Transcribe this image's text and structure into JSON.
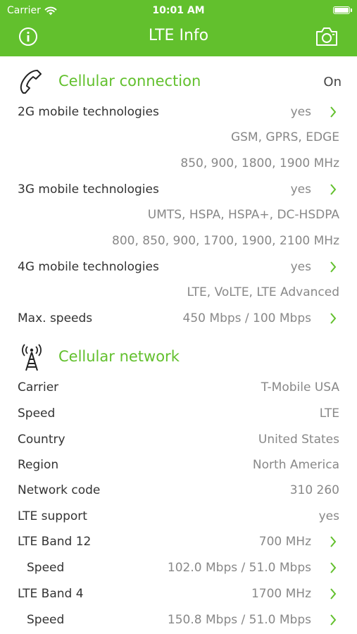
{
  "status_bar": {
    "carrier": "Carrier",
    "time": "10:01 AM"
  },
  "nav": {
    "title": "LTE Info",
    "left_icon": "info-icon",
    "right_icon": "camera-icon"
  },
  "accent_color": "#62c02d",
  "sections": {
    "cellular_connection": {
      "title": "Cellular connection",
      "status": "On",
      "icon": "phone-icon",
      "rows": [
        {
          "label": "2G mobile technologies",
          "value": "yes"
        },
        {
          "label": "",
          "value": "GSM, GPRS, EDGE"
        },
        {
          "label": "",
          "value": "850, 900, 1800, 1900 MHz"
        },
        {
          "label": "3G mobile technologies",
          "value": "yes"
        },
        {
          "label": "",
          "value": "UMTS, HSPA, HSPA+, DC-HSDPA"
        },
        {
          "label": "",
          "value": "800, 850, 900, 1700, 1900, 2100 MHz"
        },
        {
          "label": "4G mobile technologies",
          "value": "yes"
        },
        {
          "label": "",
          "value": "LTE, VoLTE, LTE Advanced"
        },
        {
          "label": "Max. speeds",
          "value": "450 Mbps / 100 Mbps"
        }
      ]
    },
    "cellular_network": {
      "title": "Cellular network",
      "icon": "antenna-tower-icon",
      "rows": [
        {
          "label": "Carrier",
          "value": "T-Mobile USA"
        },
        {
          "label": "Speed",
          "value": "LTE"
        },
        {
          "label": "Country",
          "value": "United States"
        },
        {
          "label": "Region",
          "value": "North America"
        },
        {
          "label": "Network code",
          "value": "310 260"
        },
        {
          "label": "LTE support",
          "value": "yes"
        },
        {
          "label": "LTE Band 12",
          "value": "700 MHz"
        },
        {
          "label": "Speed",
          "value": "102.0 Mbps / 51.0 Mbps"
        },
        {
          "label": "LTE Band 4",
          "value": "1700 MHz"
        },
        {
          "label": "Speed",
          "value": "150.8 Mbps / 51.0 Mbps"
        }
      ]
    }
  }
}
